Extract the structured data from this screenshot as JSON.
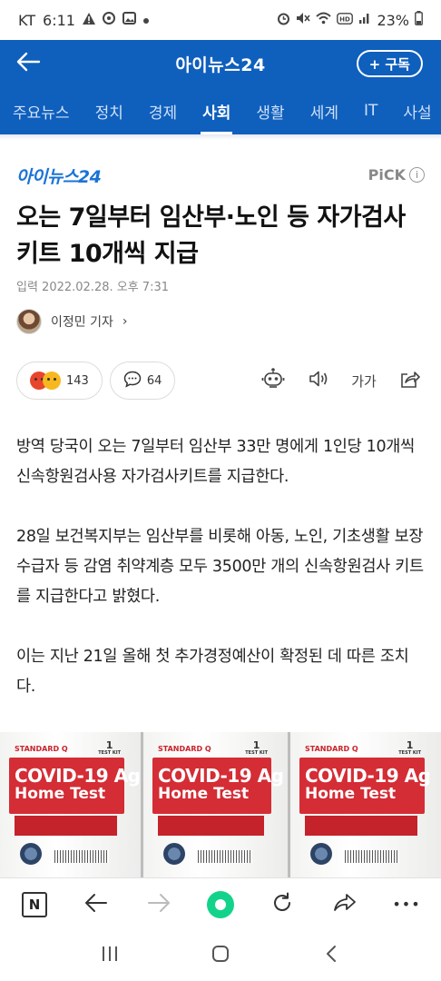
{
  "status_bar": {
    "carrier": "KT",
    "time": "6:11",
    "battery": "23%",
    "left_icons": [
      "warning-icon",
      "notification-icon",
      "gallery-icon",
      "dot-icon"
    ],
    "right_icons": [
      "alarm-icon",
      "mute-icon",
      "wifi-icon",
      "hd-icon",
      "signal-icon",
      "battery-icon"
    ]
  },
  "header": {
    "title": "아이뉴스24",
    "subscribe_label": "+ 구독"
  },
  "categories": [
    {
      "label": "주요뉴스",
      "active": false
    },
    {
      "label": "정치",
      "active": false
    },
    {
      "label": "경제",
      "active": false
    },
    {
      "label": "사회",
      "active": true
    },
    {
      "label": "생활",
      "active": false
    },
    {
      "label": "세계",
      "active": false
    },
    {
      "label": "IT",
      "active": false
    },
    {
      "label": "사설",
      "active": false
    }
  ],
  "article": {
    "brand": "아이뉴스24",
    "pick_label": "PiCK",
    "headline": "오는 7일부터 임산부·노인 등 자가검사키트 10개씩 지급",
    "date": "입력 2022.02.28. 오후 7:31",
    "reporter": "이정민 기자",
    "reporter_chevron": "›",
    "reaction_count": "143",
    "comment_count": "64",
    "font_size_label": "가가",
    "paragraphs": [
      "방역 당국이 오는 7일부터 임산부 33만 명에게 1인당 10개씩 신속항원검사용 자가검사키트를 지급한다.",
      "28일 보건복지부는 임산부를 비롯해 아동, 노인, 기초생활 보장 수급자 등 감염 취약계층 모두 3500만 개의 신속항원검사 키트를 지급한다고 밝혔다.",
      "이는 지난 21일 올해 첫 추가경정예산이 확정된 데 따른 조치다."
    ]
  },
  "image": {
    "boxes": [
      {
        "brand": "STANDARD Q",
        "line1": "COVID-19 Ag",
        "line2": "Home Test",
        "count": "1",
        "count_unit": "TEST KIT"
      },
      {
        "brand": "STANDARD Q",
        "line1": "COVID-19 Ag",
        "line2": "Home Test",
        "count": "1",
        "count_unit": "TEST KIT"
      },
      {
        "brand": "STANDARD Q",
        "line1": "COVID-19 Ag",
        "line2": "Home Test",
        "count": "1",
        "count_unit": "TEST KIT"
      }
    ]
  },
  "browser_bar": {
    "naver_label": "N",
    "more_label": "•••"
  },
  "colors": {
    "header_bg": "#0f5fbd",
    "brand_blue": "#1a74d6",
    "green_button": "#13d38a"
  }
}
